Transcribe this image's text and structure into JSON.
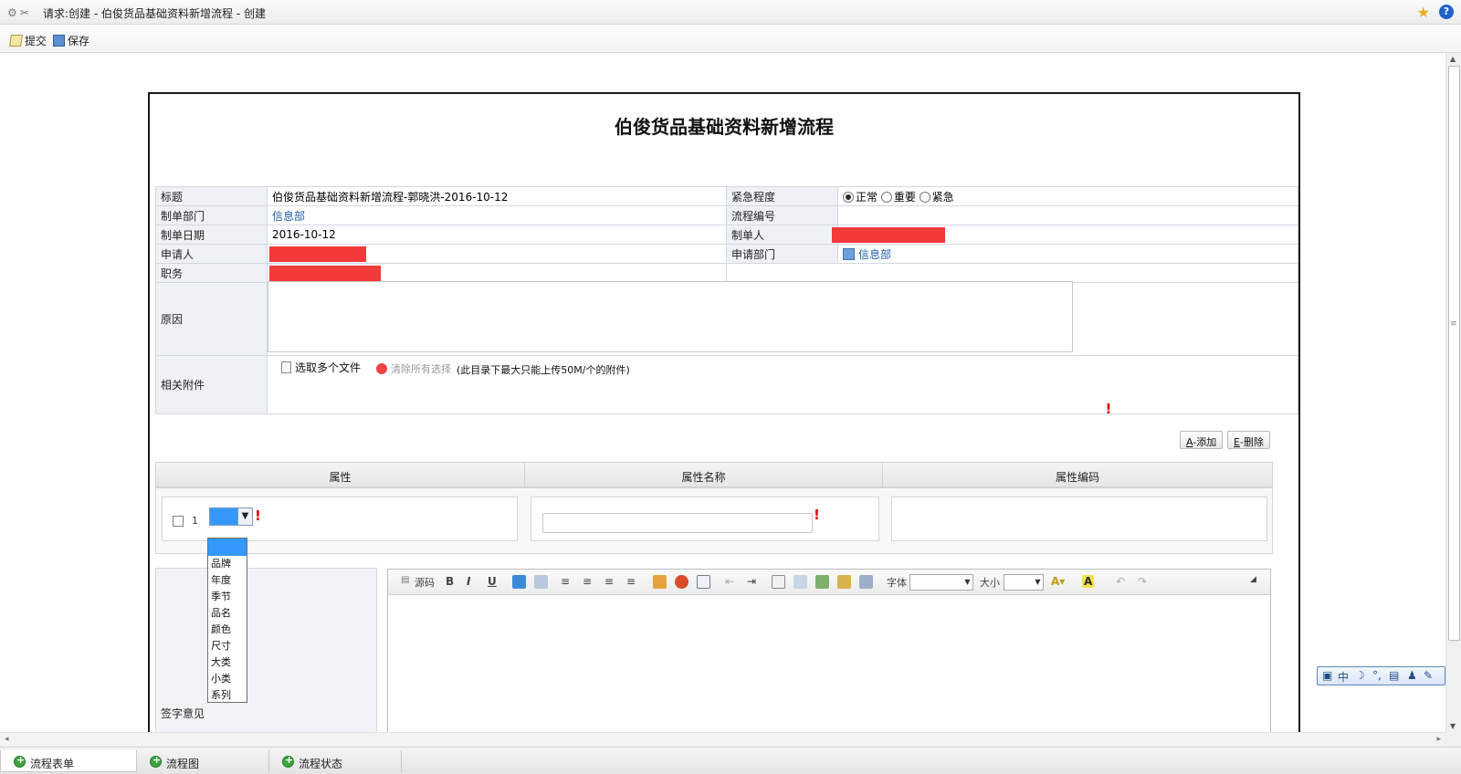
{
  "window": {
    "title": "请求:创建 - 伯俊货品基础资料新增流程 - 创建"
  },
  "toolbar": {
    "submit_label": "提交",
    "save_label": "保存"
  },
  "form": {
    "title": "伯俊货品基础资料新增流程",
    "fields": {
      "subject_label": "标题",
      "subject_value": "伯俊货品基础资料新增流程-郭晓洪-2016-10-12",
      "urgency_label": "紧急程度",
      "urgency_options": [
        "正常",
        "重要",
        "紧急"
      ],
      "urgency_selected": "正常",
      "dept_label": "制单部门",
      "dept_value": "信息部",
      "flow_no_label": "流程编号",
      "date_label": "制单日期",
      "date_value": "2016-10-12",
      "creator_label": "制单人",
      "applicant_label": "申请人",
      "apply_dept_label": "申请部门",
      "apply_dept_value": "信息部",
      "position_label": "职务",
      "reason_label": "原因",
      "attach_label": "相关附件",
      "attach_pick": "选取多个文件",
      "attach_clear": "清除所有选择",
      "attach_note": "(此目录下最大只能上传50M/个的附件)"
    },
    "buttons": {
      "add_key": "A",
      "add_label": "-添加",
      "delete_key": "E",
      "delete_label": "-删除"
    },
    "subtable": {
      "headers": [
        "属性",
        "属性名称",
        "属性编码"
      ],
      "row_number": "1",
      "attribute_options": [
        "品牌",
        "年度",
        "季节",
        "品名",
        "颜色",
        "尺寸",
        "大类",
        "小类",
        "系列"
      ]
    },
    "sign_label": "签字意见"
  },
  "editor": {
    "source_label": "源码",
    "font_label": "字体",
    "size_label": "大小"
  },
  "bottom_tabs": [
    "流程表单",
    "流程图",
    "流程状态"
  ],
  "ime": {
    "mode_label": "中"
  },
  "colors": {
    "required_mark": "#e00000",
    "link": "#1f5fa8",
    "selection": "#3399ff"
  }
}
